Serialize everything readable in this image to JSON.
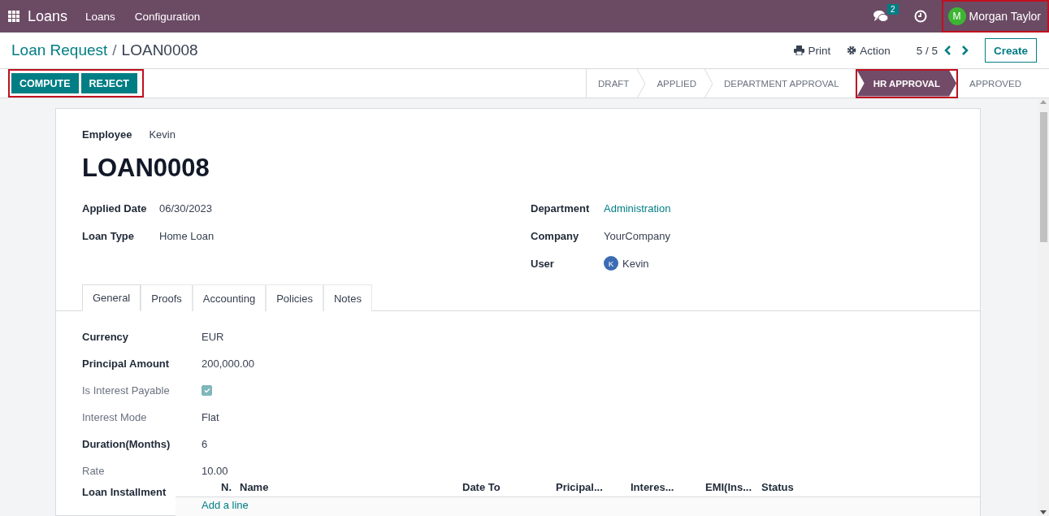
{
  "navbar": {
    "app_title": "Loans",
    "menus": [
      "Loans",
      "Configuration"
    ],
    "messages_badge": "2",
    "user": {
      "initial": "M",
      "name": "Morgan Taylor",
      "highlighted": true
    }
  },
  "breadcrumb": {
    "parent": "Loan Request",
    "separator": "/",
    "current": "LOAN0008"
  },
  "toolbar": {
    "print": "Print",
    "action": "Action",
    "pager": "5 / 5",
    "create": "Create"
  },
  "action_buttons": {
    "highlighted": true,
    "buttons": [
      "COMPUTE",
      "REJECT"
    ]
  },
  "status_steps": [
    {
      "label": "DRAFT",
      "selected": false,
      "highlighted": false
    },
    {
      "label": "APPLIED",
      "selected": false,
      "highlighted": false
    },
    {
      "label": "DEPARTMENT APPROVAL",
      "selected": false,
      "highlighted": false
    },
    {
      "label": "HR APPROVAL",
      "selected": true,
      "highlighted": true
    },
    {
      "label": "APPROVED",
      "selected": false,
      "highlighted": false
    }
  ],
  "form": {
    "employee": {
      "label": "Employee",
      "value": "Kevin"
    },
    "title": "LOAN0008",
    "left_fields": [
      {
        "label": "Applied Date",
        "value": "06/30/2023"
      },
      {
        "label": "Loan Type",
        "value": "Home Loan"
      }
    ],
    "right_fields": [
      {
        "label": "Department",
        "value": "Administration",
        "kind": "link"
      },
      {
        "label": "Company",
        "value": "YourCompany",
        "kind": "text"
      },
      {
        "label": "User",
        "value": "Kevin",
        "kind": "avatar",
        "initial": "K"
      }
    ]
  },
  "tabs": [
    {
      "label": "General",
      "selected": true
    },
    {
      "label": "Proofs",
      "selected": false
    },
    {
      "label": "Accounting",
      "selected": false
    },
    {
      "label": "Policies",
      "selected": false
    },
    {
      "label": "Notes",
      "selected": false
    }
  ],
  "general_fields": [
    {
      "label": "Currency",
      "value": "EUR",
      "kind": "text",
      "muted": false
    },
    {
      "label": "Principal Amount",
      "value": "200,000.00",
      "kind": "text",
      "muted": false
    },
    {
      "label": "Is Interest Payable",
      "kind": "checkbox",
      "checked": true,
      "muted": true
    },
    {
      "label": "Interest Mode",
      "value": "Flat",
      "kind": "text",
      "muted": true
    },
    {
      "label": "Duration(Months)",
      "value": "6",
      "kind": "text",
      "muted": false
    },
    {
      "label": "Rate",
      "value": "10.00",
      "kind": "text",
      "muted": true
    }
  ],
  "installments": {
    "label": "Loan Installment",
    "columns": [
      "N.",
      "Name",
      "Date To",
      "Pricipal...",
      "Interes...",
      "EMI(Ins...",
      "Status"
    ],
    "add_line": "Add a line"
  }
}
